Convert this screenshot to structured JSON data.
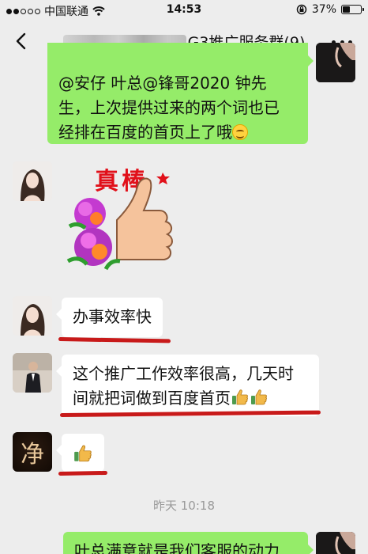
{
  "status_bar": {
    "carrier": "中国联通",
    "time": "14:53",
    "battery": "37%"
  },
  "header": {
    "title_suffix": "G3推广服务群(9)"
  },
  "messages": {
    "m1": {
      "text_line1": "@安仔 叶总@锋哥2020 钟先",
      "text_line2": "生，上次提供过来的两个词也已",
      "text_line3": "经排在百度的首页上了哦"
    },
    "m2": {
      "sticker_text": "真棒"
    },
    "m3": {
      "text": "办事效率快"
    },
    "m4": {
      "text_line1": "这个推广工作效率很高，几天时",
      "text_line2": "间就把词做到百度首页"
    },
    "m5": {
      "avatar_char": "净"
    },
    "m6": {
      "text": "叶总满意就是我们客服的动力"
    }
  },
  "timestamp": "昨天 10:18",
  "colors": {
    "own_bubble": "#95ec69",
    "other_bubble": "#ffffff",
    "highlight_underline": "#c81a1a",
    "background": "#ededed"
  },
  "icons": [
    "back-chevron-icon",
    "more-dots-icon",
    "wifi-icon",
    "lock-rotation-icon",
    "battery-icon",
    "thumbs-up-emoji-icon",
    "smile-emoji-icon"
  ]
}
